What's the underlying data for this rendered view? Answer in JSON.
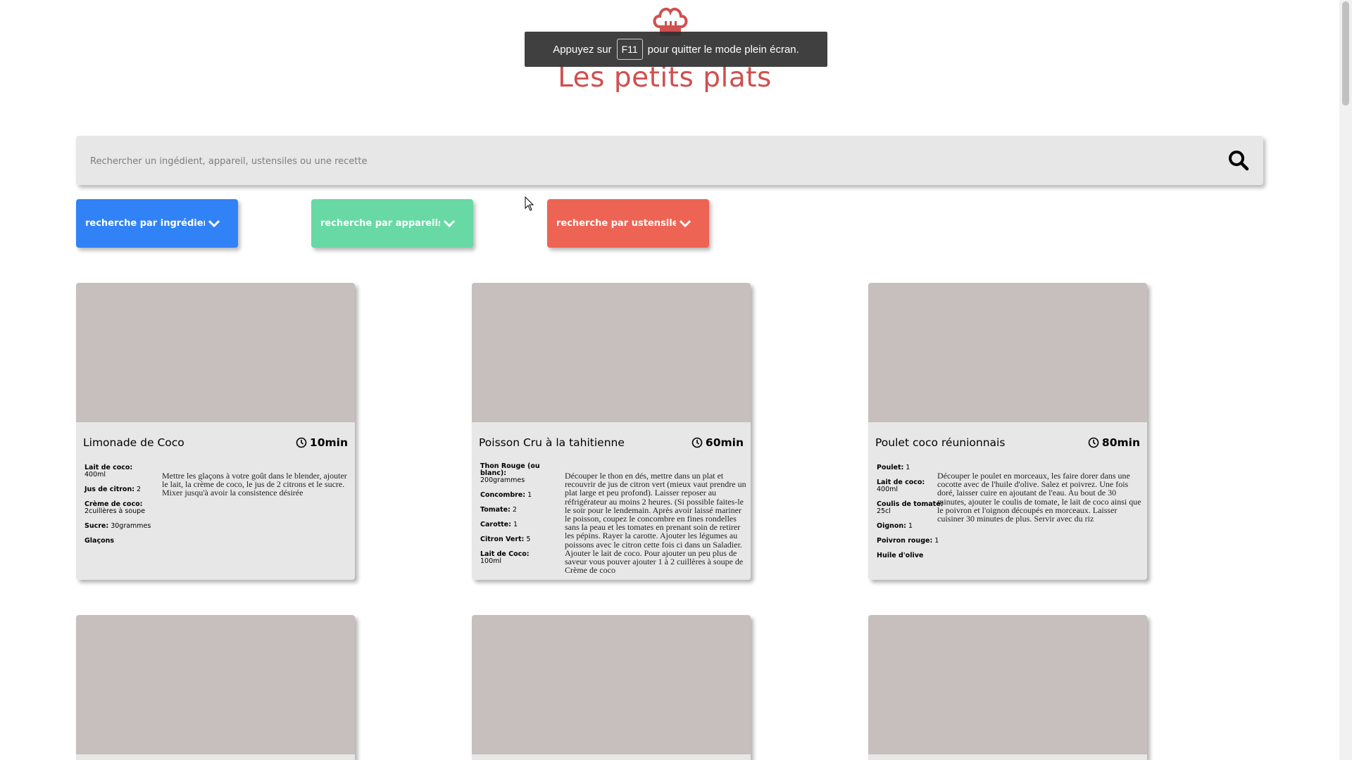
{
  "header": {
    "title": "Les petits plats"
  },
  "fullscreen_notice": {
    "prefix": "Appuyez sur",
    "key": "F11",
    "suffix": "pour quitter le mode plein écran."
  },
  "search": {
    "placeholder": "Rechercher un ingédient, appareil, ustensiles ou une recette"
  },
  "filters": [
    {
      "label": "recherche par ingrédients",
      "color": "#3282f7"
    },
    {
      "label": "recherche par appareils",
      "color": "#68d9a4"
    },
    {
      "label": "recherche par ustensiles",
      "color": "#ed6454"
    }
  ],
  "recipes": [
    {
      "name": "Limonade de Coco",
      "time": "10min",
      "ingredients": [
        {
          "name": "Lait de coco:",
          "qty": "400ml"
        },
        {
          "name": "Jus de citron:",
          "qty": "2"
        },
        {
          "name": "Crème de coco:",
          "qty": "2cuillères à soupe"
        },
        {
          "name": "Sucre:",
          "qty": "30grammes"
        },
        {
          "name": "Glaçons",
          "qty": ""
        }
      ],
      "description": "Mettre les glaçons à votre goût dans le blender, ajouter le lait, la crème de coco, le jus de 2 citrons et le sucre. Mixer jusqu'à avoir la consistence désirée"
    },
    {
      "name": "Poisson Cru à la tahitienne",
      "time": "60min",
      "ingredients": [
        {
          "name": "Thon Rouge (ou blanc):",
          "qty": "200grammes"
        },
        {
          "name": "Concombre:",
          "qty": "1"
        },
        {
          "name": "Tomate:",
          "qty": "2"
        },
        {
          "name": "Carotte:",
          "qty": "1"
        },
        {
          "name": "Citron Vert:",
          "qty": "5"
        },
        {
          "name": "Lait de Coco:",
          "qty": "100ml"
        }
      ],
      "description": "Découper le thon en dés, mettre dans un plat et recouvrir de jus de citron vert (mieux vaut prendre un plat large et peu profond). Laisser reposer au réfrigérateur au moins 2 heures. (Si possible faites-le le soir pour le lendemain. Après avoir laissé mariner le poisson, coupez le concombre en fines rondelles sans la peau et les tomates en prenant soin de retirer les pépins. Rayer la carotte. Ajouter les légumes au poissons avec le citron cette fois ci dans un Saladier. Ajouter le lait de coco. Pour ajouter un peu plus de saveur vous pouver ajouter 1 à 2 cuillères à soupe de Crème de coco"
    },
    {
      "name": "Poulet coco réunionnais",
      "time": "80min",
      "ingredients": [
        {
          "name": "Poulet:",
          "qty": "1"
        },
        {
          "name": "Lait de coco:",
          "qty": "400ml"
        },
        {
          "name": "Coulis de tomate:",
          "qty": "25cl"
        },
        {
          "name": "Oignon:",
          "qty": "1"
        },
        {
          "name": "Poivron rouge:",
          "qty": "1"
        },
        {
          "name": "Huile d'olive",
          "qty": ""
        }
      ],
      "description": "Découper le poulet en morceaux, les faire dorer dans une cocotte avec de l'huile d'olive. Salez et poivrez. Une fois doré, laisser cuire en ajoutant de l'eau. Au bout de 30 minutes, ajouter le coulis de tomate, le lait de coco ainsi que le poivron et l'oignon découpés en morceaux. Laisser cuisiner 30 minutes de plus. Servir avec du riz"
    }
  ]
}
